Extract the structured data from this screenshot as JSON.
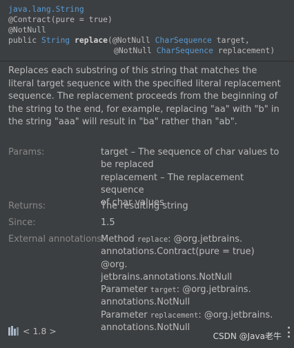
{
  "signature": {
    "class_link": "java.lang.String",
    "line2": "@Contract(pure = true)",
    "line3": "@NotNull",
    "line4_pre": "public ",
    "line4_type": "String",
    "line4_space": " ",
    "line4_method": "replace",
    "line4_paren": "(@NotNull ",
    "line4_ptype": "CharSequence",
    "line4_post": " target,",
    "line5_pre": "@NotNull ",
    "line5_ptype": "CharSequence",
    "line5_post": " replacement)"
  },
  "description": "Replaces each substring of this string that matches the literal target sequence with the specified literal replacement sequence. The replacement proceeds from the beginning of the string to the end, for example, replacing \"aa\" with \"b\" in the string \"aaa\" will result in \"ba\" rather than \"ab\".",
  "params": {
    "label": "Params:",
    "line1": "target – The sequence of char values to",
    "line2": "be replaced",
    "line3": "replacement – The replacement sequence",
    "line4": "of char values"
  },
  "returns": {
    "label": "Returns:",
    "value": "The resulting string"
  },
  "since": {
    "label": "Since:",
    "value": "1.5"
  },
  "external": {
    "label": "External annotations:",
    "l1_pre": "Method ",
    "l1_code": "replace",
    "l1_post": ": @org.jetbrains.",
    "l2": "annotations.Contract(pure = true) @org.",
    "l3": "jetbrains.annotations.NotNull",
    "l4_pre": "Parameter ",
    "l4_code": "target",
    "l4_post": ": @org.jetbrains.",
    "l5": "annotations.NotNull",
    "l6_pre": "Parameter ",
    "l6_code": "replacement",
    "l6_post": ": @org.jetbrains.",
    "l7": "annotations.NotNull"
  },
  "footer": {
    "library": "< 1.8 >",
    "library_icon": "library-icon"
  },
  "watermark": "CSDN @Java老牛",
  "colors": {
    "background": "#3c3f41",
    "link": "#5a9bd5",
    "label": "#888888",
    "text": "#bbbbbb"
  }
}
